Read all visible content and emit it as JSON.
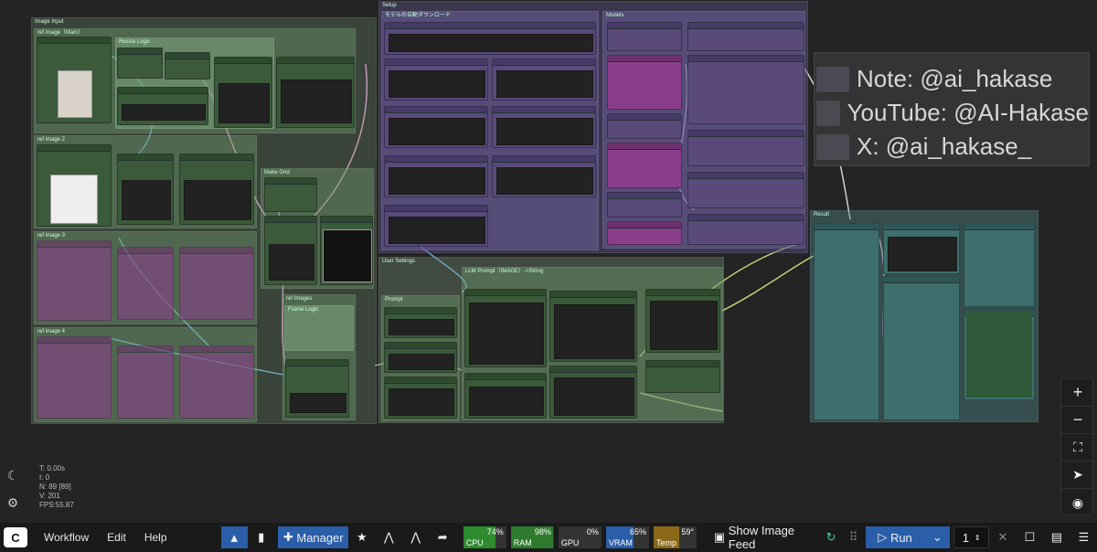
{
  "groups": {
    "image_input": "Image Input",
    "ref_main": "ref image（Main）",
    "resize_logic": "Resize Logic",
    "ref2": "ref image 2",
    "ref3": "ref image 3",
    "ref4": "ref image 4",
    "setup": "Setup",
    "auto_dl": "モデルの自動ダウンロード",
    "models": "Models",
    "user_settings": "User Settings",
    "llm_prompt": "LLM Prompt（IMAGE）->String",
    "prompt": "Prompt",
    "make_grid": "Make Grid",
    "ref_images": "ref Images",
    "frame_logic": "Frame Logic",
    "result": "Result"
  },
  "note": [
    "Note: @ai_hakase",
    "YouTube: @AI-Hakase",
    "X: @ai_hakase_"
  ],
  "stats": [
    "T: 0.00s",
    "I: 0",
    "N: 89 [89]",
    "V: 201",
    "FPS:55.87"
  ],
  "colors": {
    "accent": "#2a5ea8",
    "cpu": "#2e8b2e",
    "ram": "#2e7a2e",
    "vram": "#2a5ea8",
    "temp": "#8a6a1a"
  },
  "menu": {
    "workflow": "Workflow",
    "edit": "Edit",
    "help": "Help"
  },
  "toolbar": {
    "manager": "Manager",
    "show_feed": "Show Image Feed",
    "run": "Run",
    "queue_count": "1"
  },
  "metrics": [
    {
      "name": "CPU",
      "value": "74%",
      "level": 0.74
    },
    {
      "name": "RAM",
      "value": "98%",
      "level": 0.98
    },
    {
      "name": "GPU",
      "value": "0%",
      "level": 0
    },
    {
      "name": "VRAM",
      "value": "65%",
      "level": 0.65
    },
    {
      "name": "Temp",
      "value": "59°",
      "level": 0.59
    }
  ],
  "icons": {
    "zoom_in": "plus-icon",
    "zoom_out": "minus-icon",
    "fit": "fit-view-icon",
    "locate": "locate-icon",
    "eye": "eye-icon"
  }
}
